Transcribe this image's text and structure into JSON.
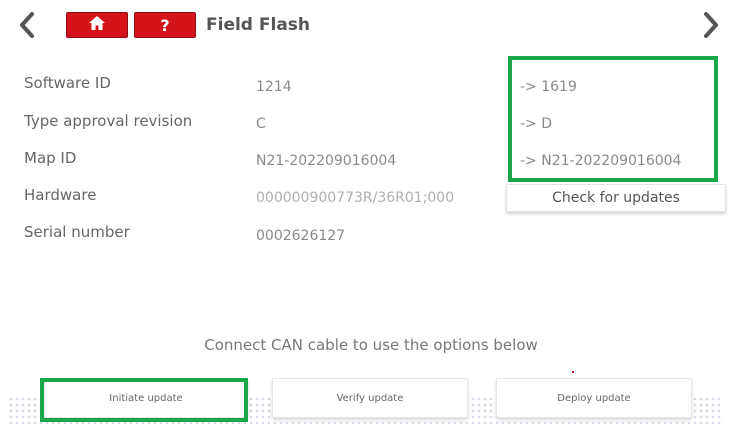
{
  "header": {
    "title": "Field Flash",
    "help_label": "?",
    "icons": {
      "back": "chevron-left-icon",
      "forward": "chevron-right-icon",
      "home": "home-icon"
    }
  },
  "info": {
    "rows": [
      {
        "label": "Software ID",
        "current": "1214",
        "new": "-> 1619"
      },
      {
        "label": "Type approval revision",
        "current": "C",
        "new": "-> D"
      },
      {
        "label": "Map ID",
        "current": "N21-202209016004",
        "new": "-> N21-202209016004"
      },
      {
        "label": "Hardware",
        "current": "000000900773R/36R01;000"
      },
      {
        "label": "Serial number",
        "current": "0002626127"
      }
    ]
  },
  "check_updates_label": "Check for updates",
  "connect_message": "Connect CAN cable to use the options below",
  "actions": {
    "initiate": "Initiate update",
    "verify": "Verify update",
    "deploy": "Deploy update"
  },
  "colors": {
    "accent_red": "#d4141b",
    "highlight_green": "#1aa64a",
    "dot_pattern": "#d5d9e8"
  }
}
